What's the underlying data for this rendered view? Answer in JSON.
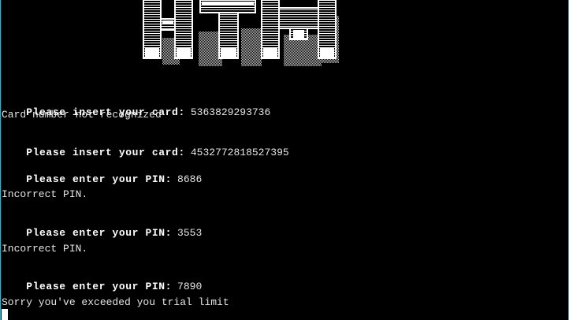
{
  "banner": {
    "text": "ATM"
  },
  "transcript": [
    {
      "prompt": "Please insert your card:",
      "value": "5363829293736"
    },
    {
      "message": "Card number not recognized"
    },
    {
      "prompt": "Please insert your card:",
      "value": "4532772818527395"
    },
    {
      "prompt": "Please enter your PIN:",
      "value": "8686"
    },
    {
      "message": "Incorrect PIN."
    },
    {
      "prompt": "Please enter your PIN:",
      "value": "3553"
    },
    {
      "message": "Incorrect PIN."
    },
    {
      "prompt": "Please enter your PIN:",
      "value": "7890"
    },
    {
      "message": "Sorry you've exceeded you trial limit"
    }
  ],
  "colors": {
    "background": "#000000",
    "text": "#e6e6e6",
    "border": "#22b8d6"
  }
}
